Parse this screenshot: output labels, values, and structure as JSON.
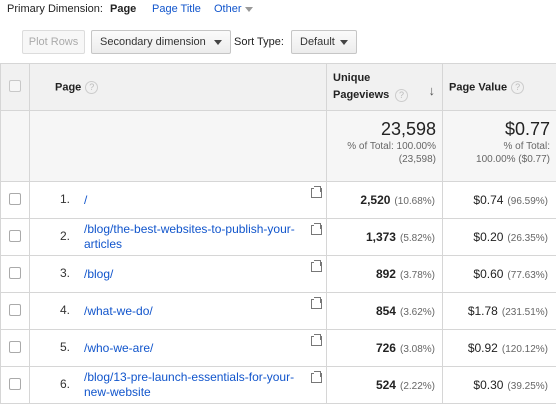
{
  "dimension_bar": {
    "label": "Primary Dimension:",
    "active": "Page",
    "options": [
      "Page Title",
      "Other"
    ]
  },
  "toolbar": {
    "plot_rows": "Plot Rows",
    "secondary_dimension": "Secondary dimension",
    "sort_type_label": "Sort Type:",
    "sort_type_value": "Default"
  },
  "table": {
    "headers": {
      "page": "Page",
      "unique_pageviews": "Unique Pageviews",
      "page_value": "Page Value"
    },
    "totals": {
      "unique_pageviews": "23,598",
      "unique_pageviews_pct": "% of Total: 100.00%",
      "unique_pageviews_sub": "(23,598)",
      "page_value": "$0.77",
      "page_value_pct": "% of Total:",
      "page_value_sub": "100.00% ($0.77)"
    },
    "rows": [
      {
        "index": "1.",
        "page": "/",
        "views": "2,520",
        "views_pct": "(10.68%)",
        "value": "$0.74",
        "value_pct": "(96.59%)"
      },
      {
        "index": "2.",
        "page": "/blog/the-best-websites-to-publish-your-articles",
        "views": "1,373",
        "views_pct": "(5.82%)",
        "value": "$0.20",
        "value_pct": "(26.35%)"
      },
      {
        "index": "3.",
        "page": "/blog/",
        "views": "892",
        "views_pct": "(3.78%)",
        "value": "$0.60",
        "value_pct": "(77.63%)"
      },
      {
        "index": "4.",
        "page": "/what-we-do/",
        "views": "854",
        "views_pct": "(3.62%)",
        "value": "$1.78",
        "value_pct": "(231.51%)"
      },
      {
        "index": "5.",
        "page": "/who-we-are/",
        "views": "726",
        "views_pct": "(3.08%)",
        "value": "$0.92",
        "value_pct": "(120.12%)"
      },
      {
        "index": "6.",
        "page": "/blog/13-pre-launch-essentials-for-your-new-website",
        "views": "524",
        "views_pct": "(2.22%)",
        "value": "$0.30",
        "value_pct": "(39.25%)"
      }
    ]
  }
}
